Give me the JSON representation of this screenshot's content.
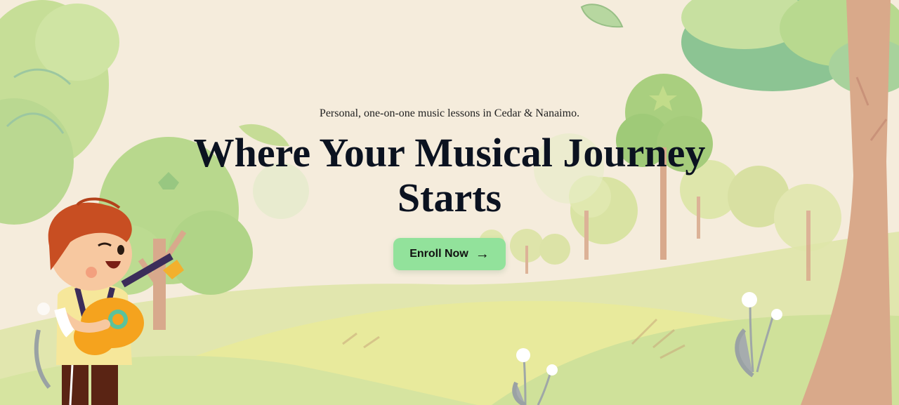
{
  "hero": {
    "tagline": "Personal, one-on-one music lessons in Cedar & Nanaimo.",
    "headline_line1": "Where Your Musical Journey",
    "headline_line2": "Starts",
    "cta_label": "Enroll Now",
    "cta_icon": "arrow-right-icon",
    "cta_arrow_glyph": "→"
  },
  "colors": {
    "background": "#f5ecdc",
    "cta_background": "#92e29b",
    "headline": "#0b1220",
    "foliage": "#b9d98a",
    "trunk": "#d9a98a"
  }
}
